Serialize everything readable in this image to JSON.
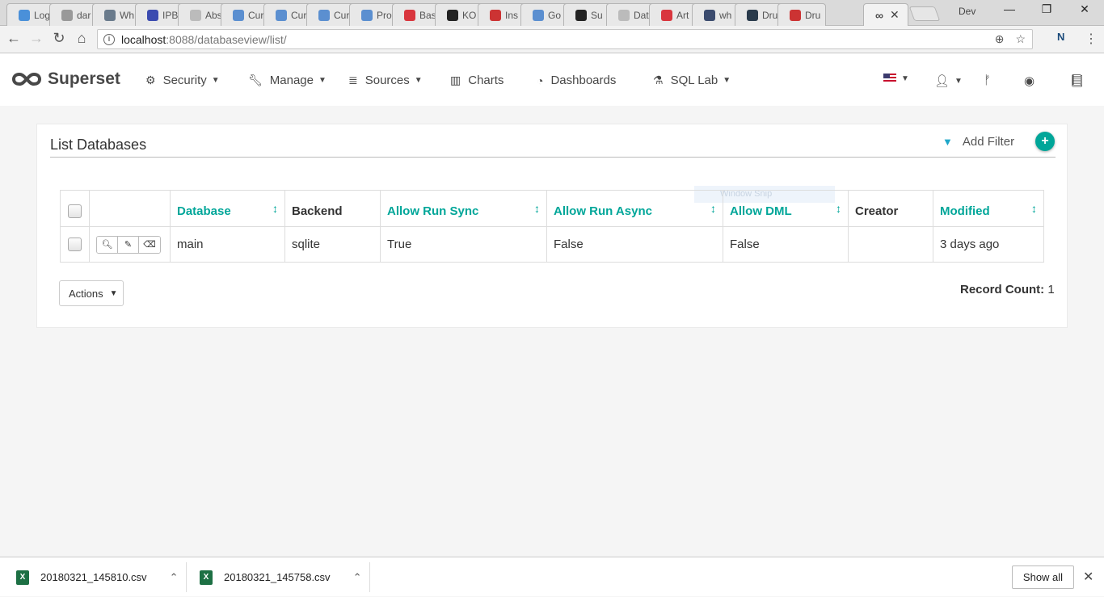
{
  "browser": {
    "tabs": [
      {
        "label": "Log",
        "color": "#4a90d9"
      },
      {
        "label": "dar",
        "color": "#999999"
      },
      {
        "label": "Wh",
        "color": "#6a7b8c"
      },
      {
        "label": "IPB",
        "color": "#3b4bb0"
      },
      {
        "label": "Abs",
        "color": "#bbbbbb"
      },
      {
        "label": "Cur",
        "color": "#5b8fd0"
      },
      {
        "label": "Cur",
        "color": "#5b8fd0"
      },
      {
        "label": "Cur",
        "color": "#5b8fd0"
      },
      {
        "label": "Pro",
        "color": "#5b8fd0"
      },
      {
        "label": "Bas",
        "color": "#d9363e"
      },
      {
        "label": "KO",
        "color": "#222222"
      },
      {
        "label": "Ins",
        "color": "#cc3333"
      },
      {
        "label": "Go",
        "color": "#5b8fd0"
      },
      {
        "label": "Su",
        "color": "#222222"
      },
      {
        "label": "Dat",
        "color": "#bbbbbb"
      },
      {
        "label": "Art",
        "color": "#d9363e"
      },
      {
        "label": "wh",
        "color": "#3b4b6e"
      },
      {
        "label": "Dru",
        "color": "#2a3b4c"
      },
      {
        "label": "Dru",
        "color": "#cc3333"
      }
    ],
    "active_tab_close": "✕",
    "profile_name": "Dev",
    "url_host": "localhost",
    "url_rest": ":8088/databaseview/list/"
  },
  "navbar": {
    "brand": "Superset",
    "security": "Security",
    "manage": "Manage",
    "sources": "Sources",
    "charts": "Charts",
    "dashboards": "Dashboards",
    "sql_lab": "SQL Lab"
  },
  "panel": {
    "title": "List Databases",
    "add_filter": "Add Filter",
    "add_button": "+",
    "overlay": "Window Snip",
    "columns": {
      "database": "Database",
      "backend": "Backend",
      "allow_run_sync": "Allow Run Sync",
      "allow_run_async": "Allow Run Async",
      "allow_dml": "Allow DML",
      "creator": "Creator",
      "modified": "Modified"
    },
    "rows": [
      {
        "database": "main",
        "backend": "sqlite",
        "allow_run_sync": "True",
        "allow_run_async": "False",
        "allow_dml": "False",
        "creator": "",
        "modified": "3 days ago"
      }
    ],
    "actions_label": "Actions",
    "record_count_label": "Record Count:",
    "record_count": "1"
  },
  "downloads": {
    "files": [
      "20180321_145810.csv",
      "20180321_145758.csv"
    ],
    "show_all": "Show all"
  },
  "colors": {
    "accent": "#00a699",
    "filter_icon": "#20a7c9"
  }
}
